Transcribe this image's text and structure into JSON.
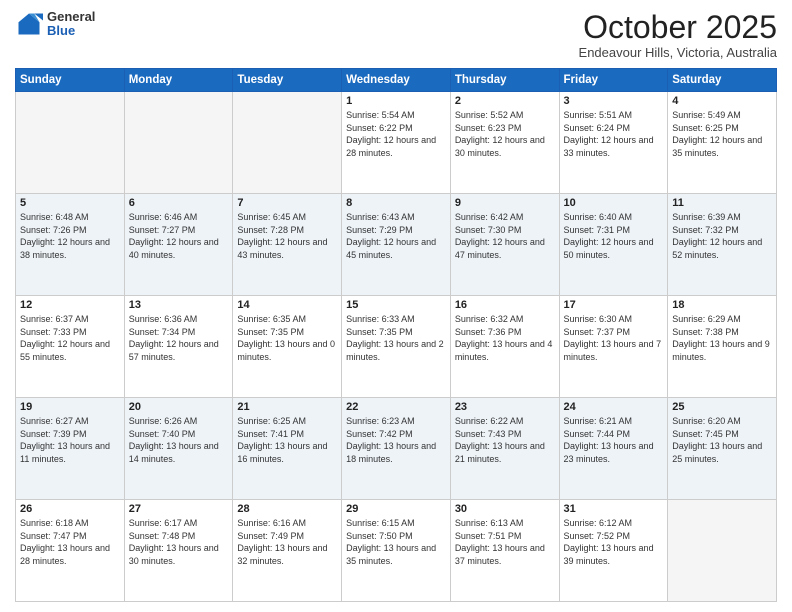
{
  "header": {
    "logo_general": "General",
    "logo_blue": "Blue",
    "month": "October 2025",
    "location": "Endeavour Hills, Victoria, Australia"
  },
  "weekdays": [
    "Sunday",
    "Monday",
    "Tuesday",
    "Wednesday",
    "Thursday",
    "Friday",
    "Saturday"
  ],
  "weeks": [
    [
      {
        "day": "",
        "info": ""
      },
      {
        "day": "",
        "info": ""
      },
      {
        "day": "",
        "info": ""
      },
      {
        "day": "1",
        "info": "Sunrise: 5:54 AM\nSunset: 6:22 PM\nDaylight: 12 hours\nand 28 minutes."
      },
      {
        "day": "2",
        "info": "Sunrise: 5:52 AM\nSunset: 6:23 PM\nDaylight: 12 hours\nand 30 minutes."
      },
      {
        "day": "3",
        "info": "Sunrise: 5:51 AM\nSunset: 6:24 PM\nDaylight: 12 hours\nand 33 minutes."
      },
      {
        "day": "4",
        "info": "Sunrise: 5:49 AM\nSunset: 6:25 PM\nDaylight: 12 hours\nand 35 minutes."
      }
    ],
    [
      {
        "day": "5",
        "info": "Sunrise: 6:48 AM\nSunset: 7:26 PM\nDaylight: 12 hours\nand 38 minutes."
      },
      {
        "day": "6",
        "info": "Sunrise: 6:46 AM\nSunset: 7:27 PM\nDaylight: 12 hours\nand 40 minutes."
      },
      {
        "day": "7",
        "info": "Sunrise: 6:45 AM\nSunset: 7:28 PM\nDaylight: 12 hours\nand 43 minutes."
      },
      {
        "day": "8",
        "info": "Sunrise: 6:43 AM\nSunset: 7:29 PM\nDaylight: 12 hours\nand 45 minutes."
      },
      {
        "day": "9",
        "info": "Sunrise: 6:42 AM\nSunset: 7:30 PM\nDaylight: 12 hours\nand 47 minutes."
      },
      {
        "day": "10",
        "info": "Sunrise: 6:40 AM\nSunset: 7:31 PM\nDaylight: 12 hours\nand 50 minutes."
      },
      {
        "day": "11",
        "info": "Sunrise: 6:39 AM\nSunset: 7:32 PM\nDaylight: 12 hours\nand 52 minutes."
      }
    ],
    [
      {
        "day": "12",
        "info": "Sunrise: 6:37 AM\nSunset: 7:33 PM\nDaylight: 12 hours\nand 55 minutes."
      },
      {
        "day": "13",
        "info": "Sunrise: 6:36 AM\nSunset: 7:34 PM\nDaylight: 12 hours\nand 57 minutes."
      },
      {
        "day": "14",
        "info": "Sunrise: 6:35 AM\nSunset: 7:35 PM\nDaylight: 13 hours\nand 0 minutes."
      },
      {
        "day": "15",
        "info": "Sunrise: 6:33 AM\nSunset: 7:35 PM\nDaylight: 13 hours\nand 2 minutes."
      },
      {
        "day": "16",
        "info": "Sunrise: 6:32 AM\nSunset: 7:36 PM\nDaylight: 13 hours\nand 4 minutes."
      },
      {
        "day": "17",
        "info": "Sunrise: 6:30 AM\nSunset: 7:37 PM\nDaylight: 13 hours\nand 7 minutes."
      },
      {
        "day": "18",
        "info": "Sunrise: 6:29 AM\nSunset: 7:38 PM\nDaylight: 13 hours\nand 9 minutes."
      }
    ],
    [
      {
        "day": "19",
        "info": "Sunrise: 6:27 AM\nSunset: 7:39 PM\nDaylight: 13 hours\nand 11 minutes."
      },
      {
        "day": "20",
        "info": "Sunrise: 6:26 AM\nSunset: 7:40 PM\nDaylight: 13 hours\nand 14 minutes."
      },
      {
        "day": "21",
        "info": "Sunrise: 6:25 AM\nSunset: 7:41 PM\nDaylight: 13 hours\nand 16 minutes."
      },
      {
        "day": "22",
        "info": "Sunrise: 6:23 AM\nSunset: 7:42 PM\nDaylight: 13 hours\nand 18 minutes."
      },
      {
        "day": "23",
        "info": "Sunrise: 6:22 AM\nSunset: 7:43 PM\nDaylight: 13 hours\nand 21 minutes."
      },
      {
        "day": "24",
        "info": "Sunrise: 6:21 AM\nSunset: 7:44 PM\nDaylight: 13 hours\nand 23 minutes."
      },
      {
        "day": "25",
        "info": "Sunrise: 6:20 AM\nSunset: 7:45 PM\nDaylight: 13 hours\nand 25 minutes."
      }
    ],
    [
      {
        "day": "26",
        "info": "Sunrise: 6:18 AM\nSunset: 7:47 PM\nDaylight: 13 hours\nand 28 minutes."
      },
      {
        "day": "27",
        "info": "Sunrise: 6:17 AM\nSunset: 7:48 PM\nDaylight: 13 hours\nand 30 minutes."
      },
      {
        "day": "28",
        "info": "Sunrise: 6:16 AM\nSunset: 7:49 PM\nDaylight: 13 hours\nand 32 minutes."
      },
      {
        "day": "29",
        "info": "Sunrise: 6:15 AM\nSunset: 7:50 PM\nDaylight: 13 hours\nand 35 minutes."
      },
      {
        "day": "30",
        "info": "Sunrise: 6:13 AM\nSunset: 7:51 PM\nDaylight: 13 hours\nand 37 minutes."
      },
      {
        "day": "31",
        "info": "Sunrise: 6:12 AM\nSunset: 7:52 PM\nDaylight: 13 hours\nand 39 minutes."
      },
      {
        "day": "",
        "info": ""
      }
    ]
  ]
}
